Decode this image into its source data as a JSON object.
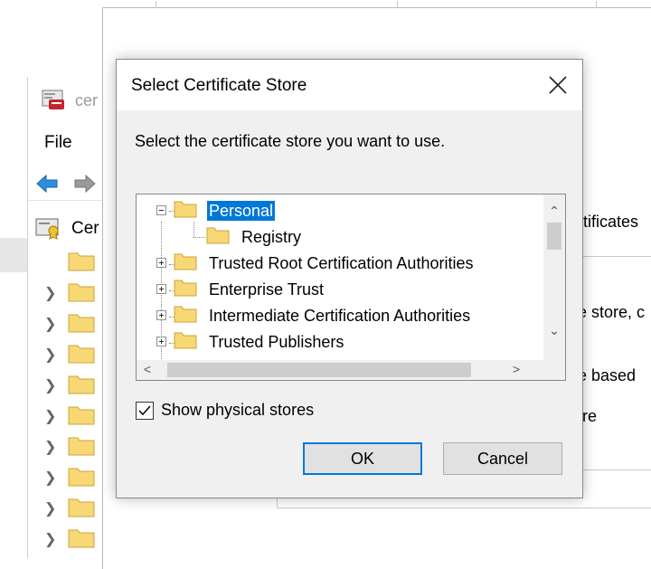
{
  "certmgr": {
    "title_partial": "cer",
    "menu_file": "File",
    "tree_root_partial": "Cer"
  },
  "wizard": {
    "text_certificates": "rtificates",
    "text_store": "e store, c",
    "text_based": "e based",
    "text_re": "re"
  },
  "dialog": {
    "title": "Select Certificate Store",
    "prompt": "Select the certificate store you want to use.",
    "tree": {
      "personal": "Personal",
      "registry": "Registry",
      "trusted_root": "Trusted Root Certification Authorities",
      "enterprise_trust": "Enterprise Trust",
      "intermediate": "Intermediate Certification Authorities",
      "trusted_publishers": "Trusted Publishers"
    },
    "show_physical_label": "Show physical stores",
    "show_physical_checked": true,
    "ok_label": "OK",
    "cancel_label": "Cancel"
  },
  "colors": {
    "selection": "#0078d7",
    "folder": "#f8d775",
    "dialog_bg": "#f0f0f0"
  },
  "icons": [
    "close-icon",
    "folder-icon",
    "checkmark-icon",
    "back-arrow-icon",
    "forward-arrow-icon",
    "certificate-icon"
  ]
}
